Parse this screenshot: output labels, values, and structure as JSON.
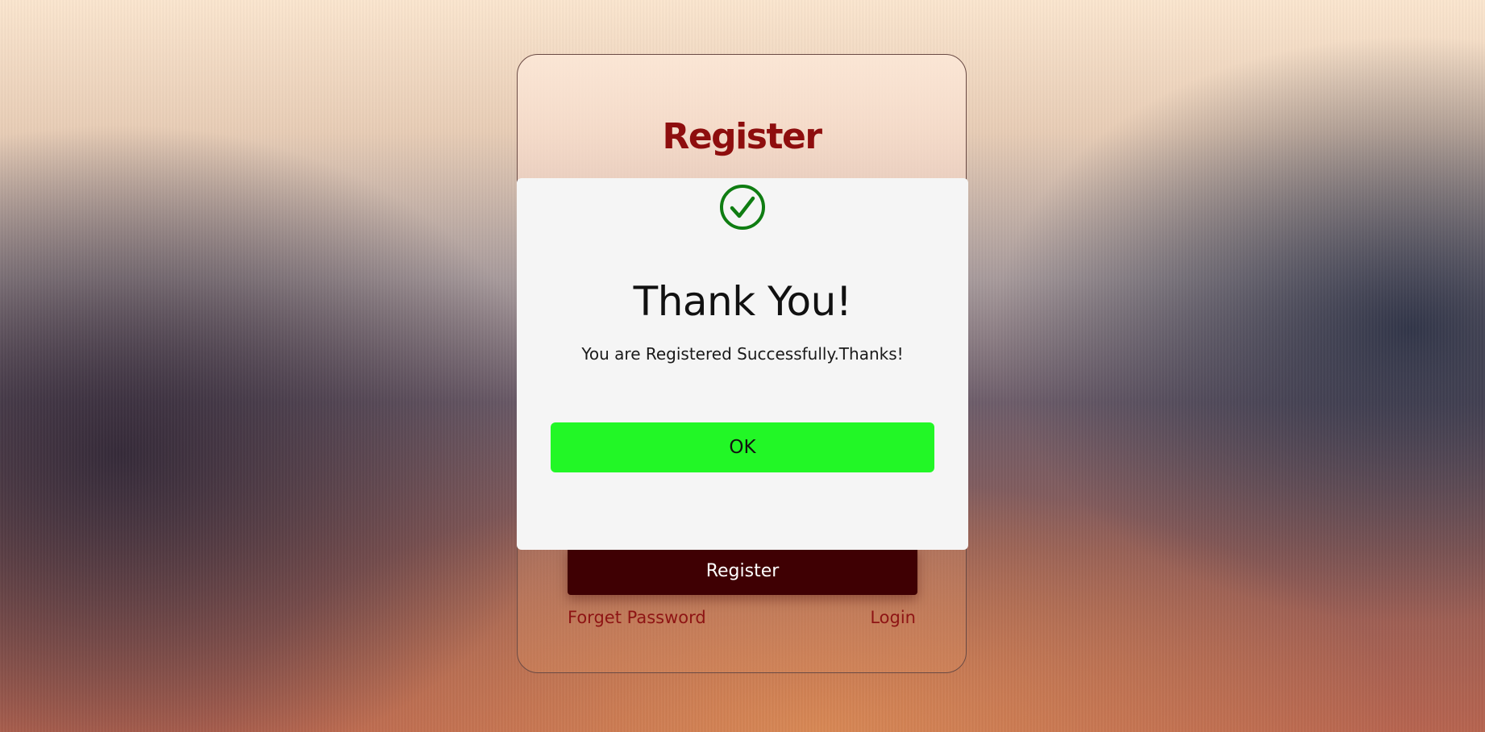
{
  "register_card": {
    "title": "Register",
    "register_button_label": "Register",
    "forget_password_label": "Forget Password",
    "login_label": "Login"
  },
  "modal": {
    "icon": "check-circle-icon",
    "icon_color": "#0f7d12",
    "title": "Thank You!",
    "message": "You are Registered Successfully.Thanks!",
    "ok_label": "OK",
    "ok_color": "#22f726"
  },
  "colors": {
    "title_red": "#8e0e0e",
    "register_button": "#3f0003",
    "link_red": "#8e1414",
    "modal_background": "#f5f5f5"
  }
}
